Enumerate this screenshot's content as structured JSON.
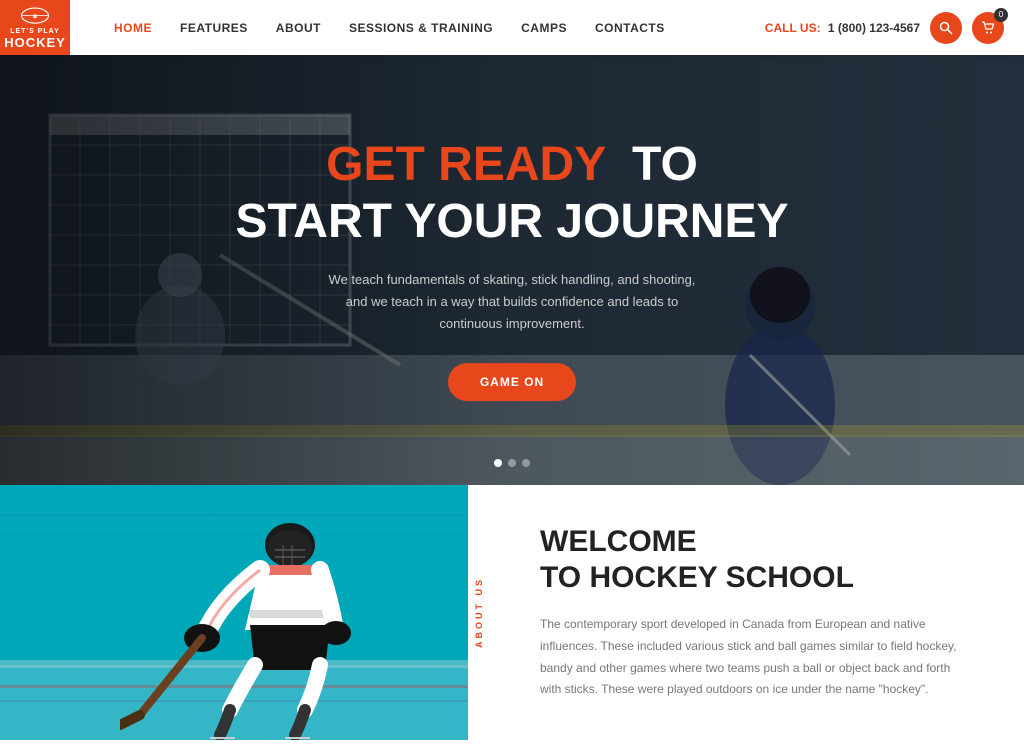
{
  "header": {
    "logo": {
      "lets": "LET'S PLAY",
      "hockey": "HOCKEY"
    },
    "nav": [
      {
        "label": "HOME",
        "active": true
      },
      {
        "label": "FEATURES",
        "active": false
      },
      {
        "label": "ABOUT",
        "active": false
      },
      {
        "label": "SESSIONS & TRAINING",
        "active": false
      },
      {
        "label": "CAMPS",
        "active": false
      },
      {
        "label": "CONTACTS",
        "active": false
      }
    ],
    "call_us_label": "CALL US:",
    "phone": "1 (800) 123-4567",
    "cart_count": "0"
  },
  "hero": {
    "title_highlight": "GET READY",
    "title_rest": "TO",
    "title_line2": "START YOUR JOURNEY",
    "subtitle": "We teach fundamentals of skating, stick handling, and shooting, and we teach in a way that builds confidence and leads to continuous improvement.",
    "cta_label": "GAME ON",
    "dots": [
      true,
      false,
      false
    ]
  },
  "about": {
    "vertical_label": "ABOUT US",
    "title_line1": "WELCOME",
    "title_line2": "TO HOCKEY SCHOOL",
    "body": "The contemporary sport developed in Canada from European and native influences. These included various stick and ball games similar to field hockey, bandy and other games where two teams push a ball or object back and forth with sticks. These were played outdoors on ice under the name \"hockey\"."
  }
}
